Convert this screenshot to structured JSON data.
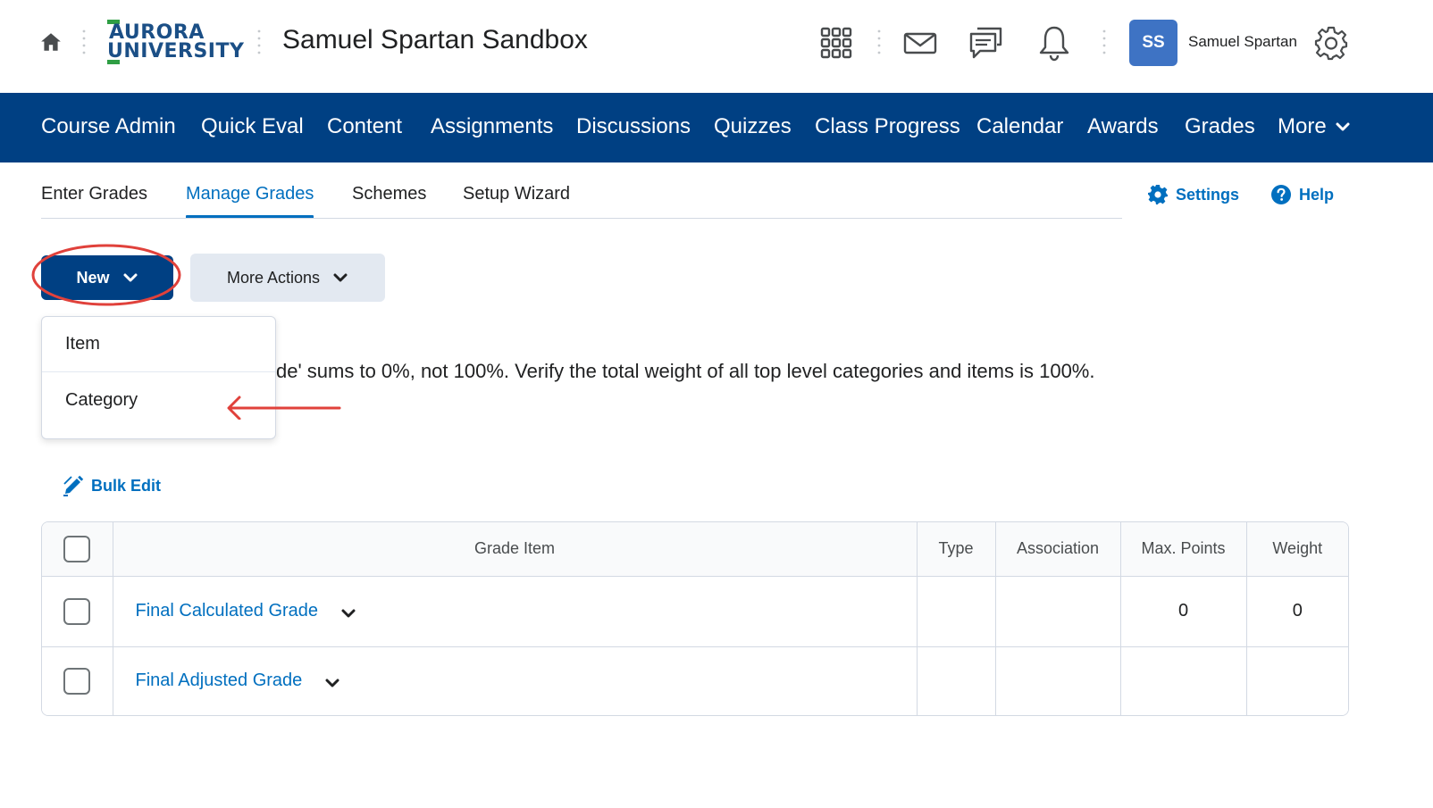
{
  "header": {
    "logo_line1": "AURORA",
    "logo_line2": "UNIVERSITY",
    "course_title": "Samuel Spartan Sandbox",
    "avatar_initials": "SS",
    "user_name": "Samuel Spartan",
    "icons": [
      "home-icon",
      "app-grid-icon",
      "mail-icon",
      "chat-icon",
      "bell-icon",
      "gear-icon"
    ]
  },
  "nav": {
    "items": [
      "Course Admin",
      "Quick Eval",
      "Content",
      "Assignments",
      "Discussions",
      "Quizzes",
      "Class Progress",
      "Calendar",
      "Awards",
      "Grades",
      "More"
    ]
  },
  "subtabs": {
    "items": [
      "Enter Grades",
      "Manage Grades",
      "Schemes",
      "Setup Wizard"
    ],
    "active": "Manage Grades",
    "settings_label": "Settings",
    "help_label": "Help"
  },
  "actions": {
    "new_label": "New",
    "more_actions_label": "More Actions"
  },
  "new_menu": {
    "items": [
      "Item",
      "Category"
    ]
  },
  "warning_text": "de' sums to 0%, not 100%. Verify the total weight of all top level categories and items is 100%.",
  "bulk_edit_label": "Bulk Edit",
  "table": {
    "columns": [
      "Grade Item",
      "Type",
      "Association",
      "Max. Points",
      "Weight"
    ],
    "rows": [
      {
        "name": "Final Calculated Grade",
        "type": "",
        "association": "",
        "max_points": "0",
        "weight": "0"
      },
      {
        "name": "Final Adjusted Grade",
        "type": "",
        "association": "",
        "max_points": "",
        "weight": ""
      }
    ]
  },
  "colors": {
    "brand_navy": "#004083",
    "link_blue": "#006fbf",
    "annotation_red": "#e0413b",
    "logo_green": "#2f9e44"
  }
}
